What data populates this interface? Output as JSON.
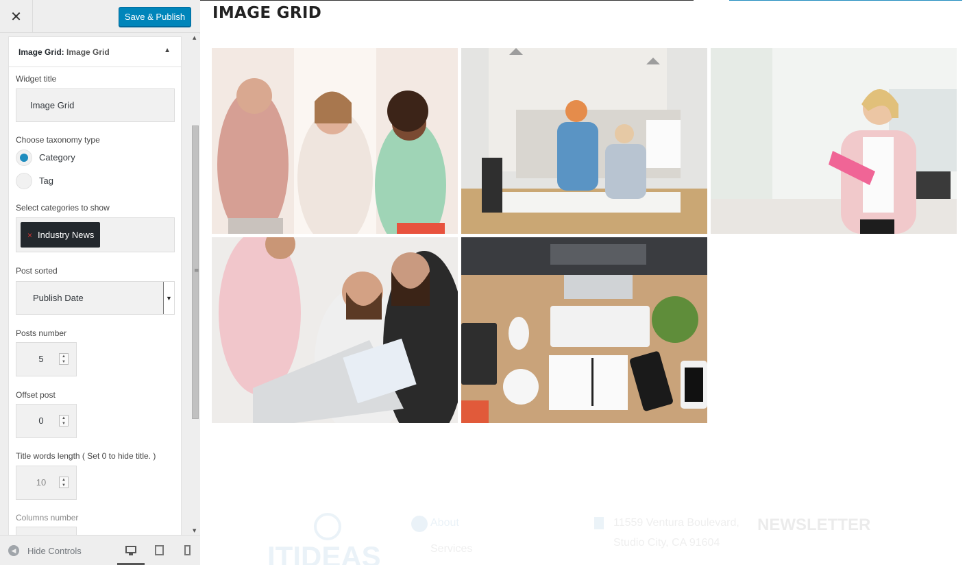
{
  "toolbar": {
    "close_icon": "close-icon",
    "save_label": "Save & Publish"
  },
  "widget": {
    "header_prefix": "Image Grid:",
    "header_name": "Image Grid",
    "collapse_icon": "triangle-up-icon",
    "title_label": "Widget title",
    "title_value": "Image Grid",
    "taxonomy_label": "Choose taxonomy type",
    "taxonomy_options": [
      {
        "label": "Category",
        "selected": true
      },
      {
        "label": "Tag",
        "selected": false
      }
    ],
    "categories_label": "Select categories to show",
    "selected_category": "Industry News",
    "chip_remove": "×",
    "sorted_label": "Post sorted",
    "sorted_value": "Publish Date",
    "posts_number_label": "Posts number",
    "posts_number_value": "5",
    "offset_label": "Offset post",
    "offset_value": "0",
    "title_words_label": "Title words length ( Set 0 to hide title. )",
    "title_words_value": "10",
    "columns_label": "Columns number"
  },
  "footer": {
    "hide_controls_label": "Hide Controls",
    "devices": [
      "desktop-icon",
      "tablet-icon",
      "mobile-icon"
    ],
    "active_device": "desktop"
  },
  "preview": {
    "title": "IMAGE GRID",
    "images": [
      "people-with-phones-and-tablets",
      "architects-with-building-model",
      "businesswoman-with-pink-folder",
      "team-looking-at-laptop",
      "desk-with-keyboard-and-phones"
    ],
    "site_footer": {
      "logo": "ITIDEAS",
      "about": "About",
      "services": "Services",
      "address_line1": "11559 Ventura Boulevard,",
      "address_line2": "Studio City, CA 91604",
      "newsletter": "NEWSLETTER"
    }
  },
  "colors": {
    "accent": "#0085ba",
    "radio_selected": "#1e8cbe",
    "chip_bg": "#23282d",
    "chip_remove": "#dc3232"
  }
}
